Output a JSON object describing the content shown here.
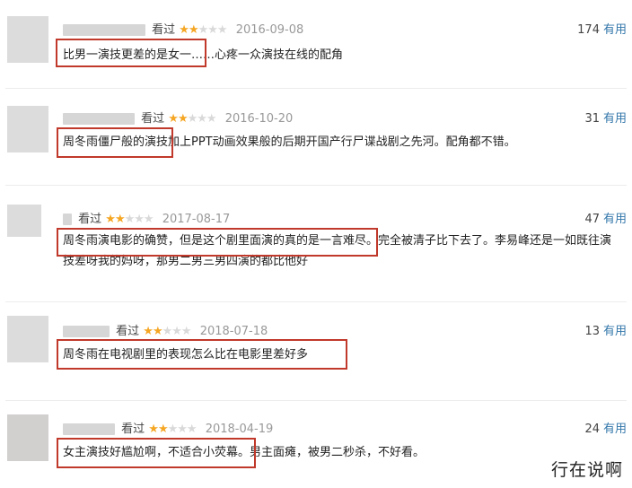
{
  "reviews": [
    {
      "status": "看过",
      "rating": 2,
      "date": "2016-09-08",
      "votes": "174",
      "useful_label": "有用",
      "text": "比男一演技更差的是女一……心疼一众演技在线的配角"
    },
    {
      "status": "看过",
      "rating": 2,
      "date": "2016-10-20",
      "votes": "31",
      "useful_label": "有用",
      "text": "周冬雨僵尸般的演技加上PPT动画效果般的后期开国产行尸谍战剧之先河。配角都不错。"
    },
    {
      "status": "看过",
      "rating": 2,
      "date": "2017-08-17",
      "votes": "47",
      "useful_label": "有用",
      "text": "周冬雨演电影的确赞，但是这个剧里面演的真的是一言难尽。完全被清子比下去了。李易峰还是一如既往演技差呀我的妈呀，那男二男三男四演的都比他好"
    },
    {
      "status": "看过",
      "rating": 2,
      "date": "2018-07-18",
      "votes": "13",
      "useful_label": "有用",
      "text": "周冬雨在电视剧里的表现怎么比在电影里差好多"
    },
    {
      "status": "看过",
      "rating": 2,
      "date": "2018-04-19",
      "votes": "24",
      "useful_label": "有用",
      "text": "女主演技好尴尬啊，不适合小荧幕。男主面瘫，被男二秒杀，不好看。"
    }
  ],
  "watermark": "行在说啊"
}
